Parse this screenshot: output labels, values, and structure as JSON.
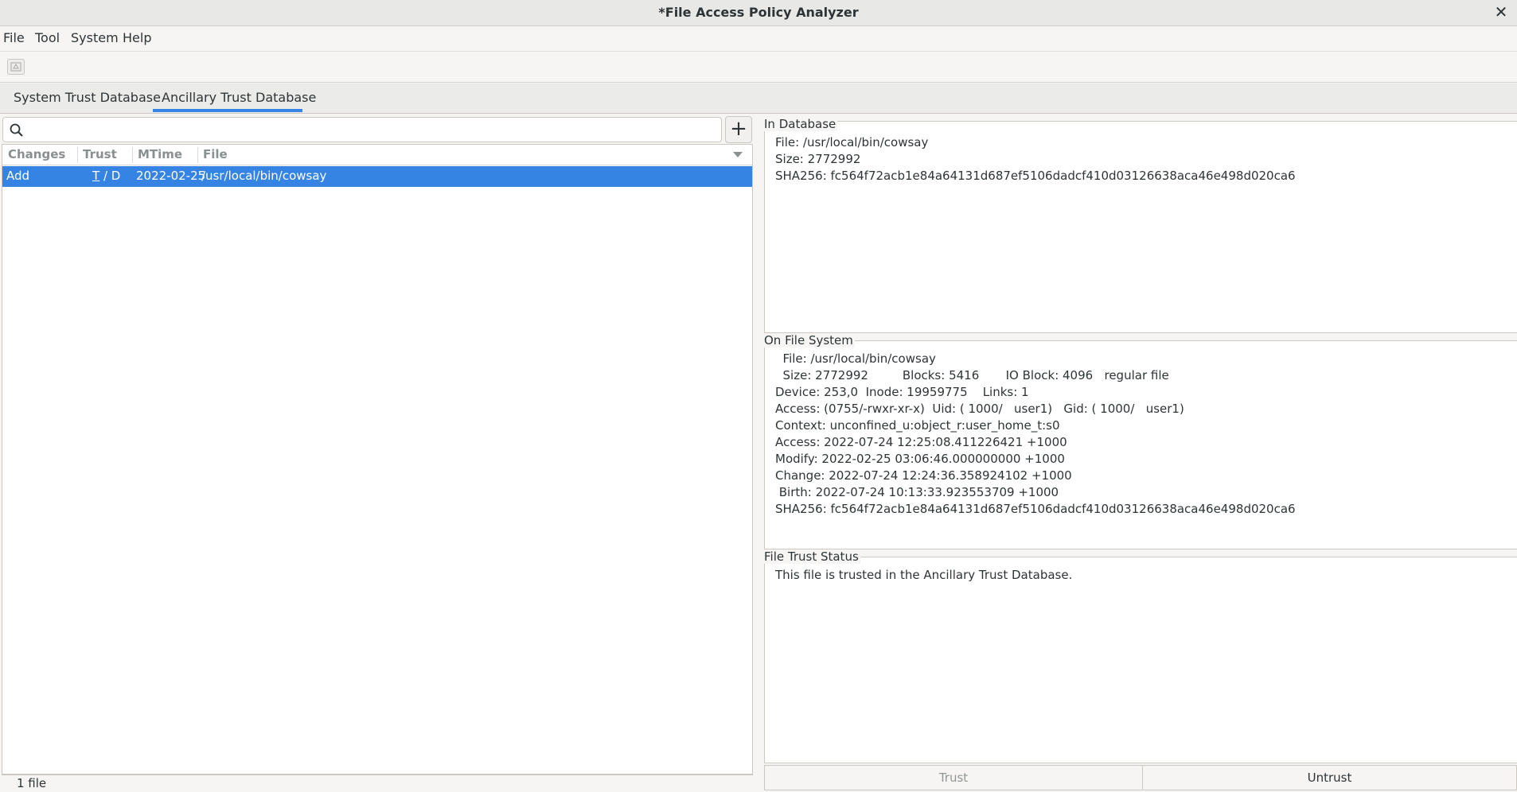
{
  "window": {
    "title": "*File Access Policy Analyzer",
    "close_glyph": "✕"
  },
  "menu": {
    "items": [
      "File",
      "Tool",
      "System",
      "Help"
    ]
  },
  "toolbar": {
    "button_icon": "document-icon"
  },
  "tabs": [
    {
      "label": "System Trust Database",
      "active": false
    },
    {
      "label": "Ancillary Trust Database",
      "active": true
    }
  ],
  "search": {
    "value": "",
    "placeholder": ""
  },
  "add_button": {
    "label": "+"
  },
  "table": {
    "columns": [
      "Changes",
      "Trust",
      "MTime",
      "File"
    ],
    "rows": [
      {
        "changes": "Add",
        "trust_t": "T",
        "trust_rest": " / D",
        "mtime": "2022-02-25",
        "file": "/usr/local/bin/cowsay",
        "selected": true
      }
    ]
  },
  "status": {
    "text": "1 file"
  },
  "in_database": {
    "label": "In Database",
    "lines": [
      "File: /usr/local/bin/cowsay",
      "Size: 2772992",
      "SHA256: fc564f72acb1e84a64131d687ef5106dadcf410d03126638aca46e498d020ca6"
    ]
  },
  "on_file_system": {
    "label": "On File System",
    "lines": [
      "  File: /usr/local/bin/cowsay",
      "  Size: 2772992         Blocks: 5416       IO Block: 4096   regular file",
      "Device: 253,0  Inode: 19959775    Links: 1",
      "Access: (0755/-rwxr-xr-x)  Uid: ( 1000/   user1)   Gid: ( 1000/   user1)",
      "Context: unconfined_u:object_r:user_home_t:s0",
      "Access: 2022-07-24 12:25:08.411226421 +1000",
      "Modify: 2022-02-25 03:06:46.000000000 +1000",
      "Change: 2022-07-24 12:24:36.358924102 +1000",
      " Birth: 2022-07-24 10:13:33.923553709 +1000",
      "SHA256: fc564f72acb1e84a64131d687ef5106dadcf410d03126638aca46e498d020ca6"
    ]
  },
  "trust_status": {
    "label": "File Trust Status",
    "lines": [
      "This file is trusted in the Ancillary Trust Database."
    ]
  },
  "buttons": {
    "trust": "Trust",
    "untrust": "Untrust"
  }
}
